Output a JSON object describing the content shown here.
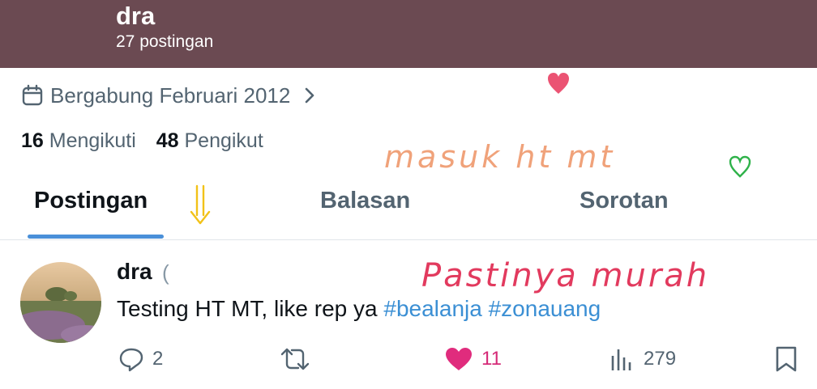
{
  "header": {
    "name": "dra",
    "post_count": "27 postingan"
  },
  "profile": {
    "joined": "Bergabung Februari 2012",
    "following_count": "16",
    "following_label": "Mengikuti",
    "followers_count": "48",
    "followers_label": "Pengikut"
  },
  "tabs": [
    {
      "label": "Postingan",
      "active": true
    },
    {
      "label": "Balasan",
      "active": false
    },
    {
      "label": "Sorotan",
      "active": false
    }
  ],
  "post": {
    "author": "dra",
    "handle_partial": "(",
    "text": "Testing HT MT, like rep ya",
    "hashtags": [
      "#bealanja",
      "#zonauang"
    ],
    "replies": "2",
    "likes": "11",
    "views": "279"
  },
  "annotations": {
    "note1": "masuk ht mt",
    "note2": "Pastinya murah"
  },
  "colors": {
    "header_bg": "#6b4a52",
    "link": "#3b8fd4",
    "like": "#d52b78",
    "tab_indicator": "#4a90d9",
    "note1": "#f0a27a",
    "note2": "#e23a5e"
  },
  "icons": [
    "calendar-icon",
    "chevron-right-icon",
    "reply-icon",
    "retweet-icon",
    "heart-icon",
    "views-icon",
    "bookmark-icon"
  ]
}
